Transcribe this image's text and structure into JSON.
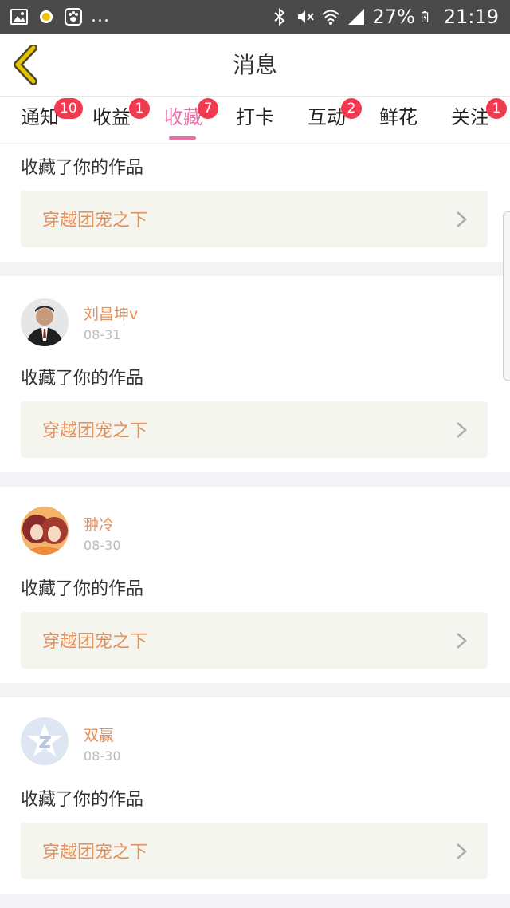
{
  "status_bar": {
    "ellipsis": "...",
    "battery": "27%",
    "time": "21:19"
  },
  "header": {
    "title": "消息",
    "accent_color": "#e8c300"
  },
  "tabs": [
    {
      "label": "通知",
      "badge": "10"
    },
    {
      "label": "收益",
      "badge": "1"
    },
    {
      "label": "收藏",
      "badge": "7",
      "active": true
    },
    {
      "label": "打卡",
      "badge": ""
    },
    {
      "label": "互动",
      "badge": "2"
    },
    {
      "label": "鲜花",
      "badge": ""
    },
    {
      "label": "关注",
      "badge": "1"
    }
  ],
  "colors": {
    "active_tab": "#e96ea5",
    "badge": "#f1394f",
    "username": "#e88f58",
    "link_background": "#f5f5ef"
  },
  "feed": [
    {
      "user": "",
      "date": "",
      "action": "收藏了你的作品",
      "work_title": "穿越团宠之下",
      "avatar": ""
    },
    {
      "user": "刘昌坤v",
      "date": "08-31",
      "action": "收藏了你的作品",
      "work_title": "穿越团宠之下",
      "avatar": "photo-man-avatar"
    },
    {
      "user": "翀冷",
      "date": "08-30",
      "action": "收藏了你的作品",
      "work_title": "穿越团宠之下",
      "avatar": "anime-girls-avatar"
    },
    {
      "user": "双赢",
      "date": "08-30",
      "action": "收藏了你的作品",
      "work_title": "穿越团宠之下",
      "avatar": "default-star-avatar"
    }
  ]
}
